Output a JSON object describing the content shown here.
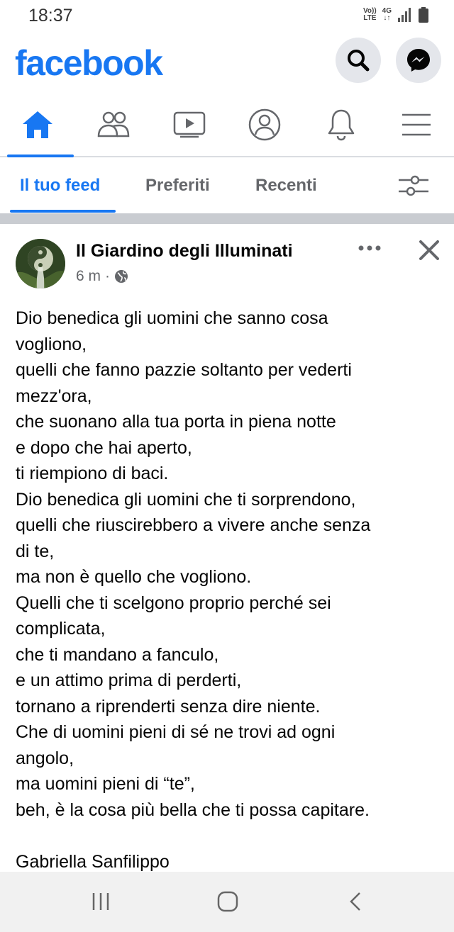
{
  "status_bar": {
    "time": "18:37",
    "volte": "Vo)) LTE",
    "network": "4G",
    "icons": [
      "volte-icon",
      "4g-icon",
      "signal-icon",
      "battery-icon"
    ]
  },
  "header": {
    "logo": "facebook",
    "brand_color": "#1877f2",
    "actions": [
      "search-icon",
      "messenger-icon"
    ]
  },
  "nav": {
    "items": [
      "home-icon",
      "friends-icon",
      "watch-icon",
      "profile-icon",
      "notifications-icon",
      "menu-icon"
    ],
    "active": "home-icon"
  },
  "feed_tabs": {
    "tabs": [
      {
        "label": "Il tuo feed",
        "active": true
      },
      {
        "label": "Preferiti",
        "active": false
      },
      {
        "label": "Recenti",
        "active": false
      }
    ],
    "filter_icon": "sliders-icon"
  },
  "post": {
    "page_name": "Il Giardino degli Illuminati",
    "time": "6 m",
    "separator": "·",
    "audience_icon": "globe-icon",
    "lines": [
      "Dio benedica gli uomini che sanno cosa",
      "vogliono,",
      "quelli che fanno pazzie soltanto per vederti",
      "mezz'ora,",
      "che suonano alla tua porta in piena notte",
      "e dopo che hai aperto,",
      "ti riempiono di baci.",
      "Dio benedica gli uomini che ti sorprendono,",
      "quelli che riuscirebbero a vivere anche senza",
      "di te,",
      "ma non è quello che vogliono.",
      "Quelli che ti scelgono proprio perché sei",
      "complicata,",
      "che ti mandano a fanculo,",
      "e un attimo prima di perderti,",
      "tornano a riprenderti senza dire niente.",
      "Che di uomini pieni di sé ne trovi ad ogni",
      "angolo,",
      "ma uomini pieni di “te”,",
      "beh, è la cosa più bella che ti possa capitare.",
      "",
      "Gabriella Sanfilippo"
    ]
  },
  "system_nav": [
    "recents-icon",
    "home-button-icon",
    "back-icon"
  ]
}
